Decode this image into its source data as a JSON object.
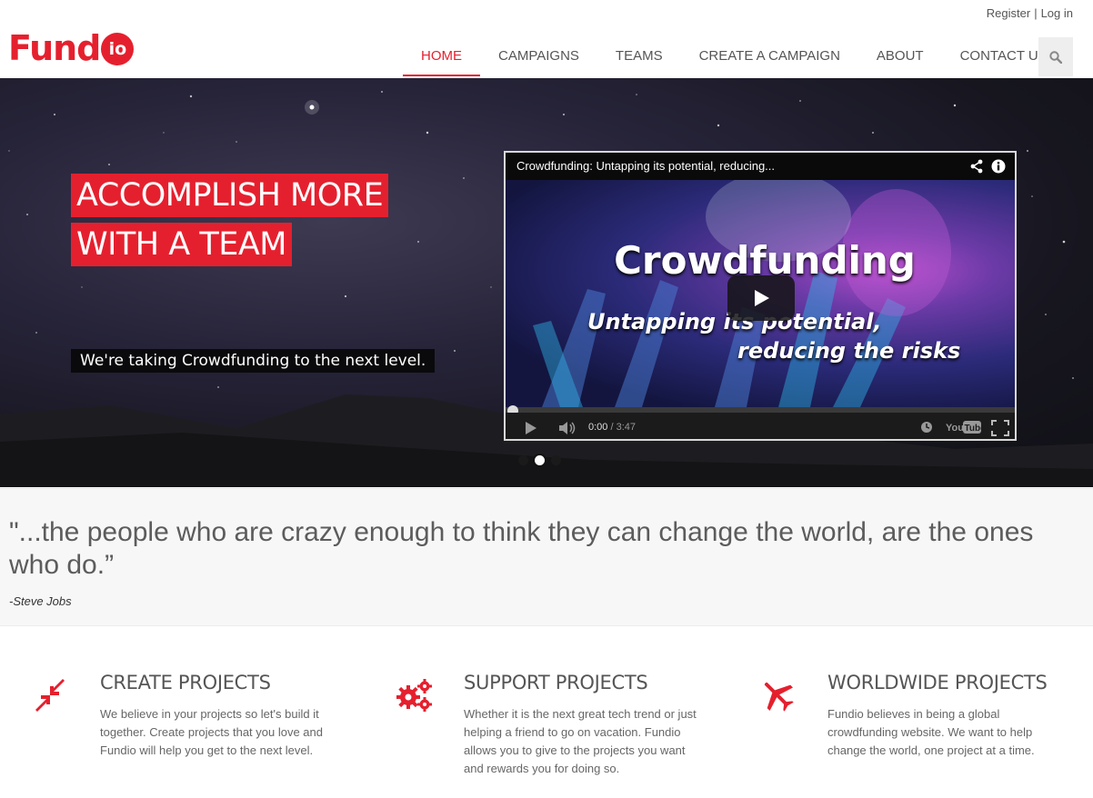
{
  "auth": {
    "register": "Register",
    "separator": "|",
    "login": "Log in"
  },
  "logo": {
    "text": "Fund",
    "badge": "io"
  },
  "nav": {
    "items": [
      {
        "label": "HOME",
        "active": true
      },
      {
        "label": "CAMPAIGNS"
      },
      {
        "label": "TEAMS"
      },
      {
        "label": "CREATE A CAMPAIGN"
      },
      {
        "label": "ABOUT"
      },
      {
        "label": "CONTACT US"
      }
    ],
    "search_icon": "search-icon"
  },
  "hero": {
    "headline_line1": "ACCOMPLISH MORE",
    "headline_line2": "WITH A TEAM",
    "tagline": "We're taking Crowdfunding to the next level.",
    "carousel": {
      "slides": 3,
      "active_index": 1
    }
  },
  "video": {
    "title": "Crowdfunding: Untapping its potential, reducing...",
    "heading": "Crowdfunding",
    "sub_line1": "Untapping its potential,",
    "sub_line2": "reducing the risks",
    "current_time": "0:00",
    "time_separator": "/",
    "duration": "3:47",
    "brand": "YouTube"
  },
  "quote": {
    "text": "\"...the people who are crazy enough to think they can change the world, are the ones who do.”",
    "author": "-Steve Jobs"
  },
  "features": [
    {
      "icon": "arrows-in-icon",
      "title": "CREATE PROJECTS",
      "text": "We believe in your projects so let's build it together. Create projects that you love and Fundio will help you get to the next level."
    },
    {
      "icon": "gears-icon",
      "title": "SUPPORT PROJECTS",
      "text": "Whether it is the next great tech trend or just helping a friend to go on vacation. Fundio allows you to give to the projects you want and rewards you for doing so."
    },
    {
      "icon": "airplane-icon",
      "title": "WORLDWIDE PROJECTS",
      "text": "Fundio believes in being a global crowdfunding website. We want to help change the world, one project at a time."
    }
  ],
  "colors": {
    "accent": "#e5202e",
    "text": "#555555",
    "hero_bg": "#1d1b2a"
  }
}
